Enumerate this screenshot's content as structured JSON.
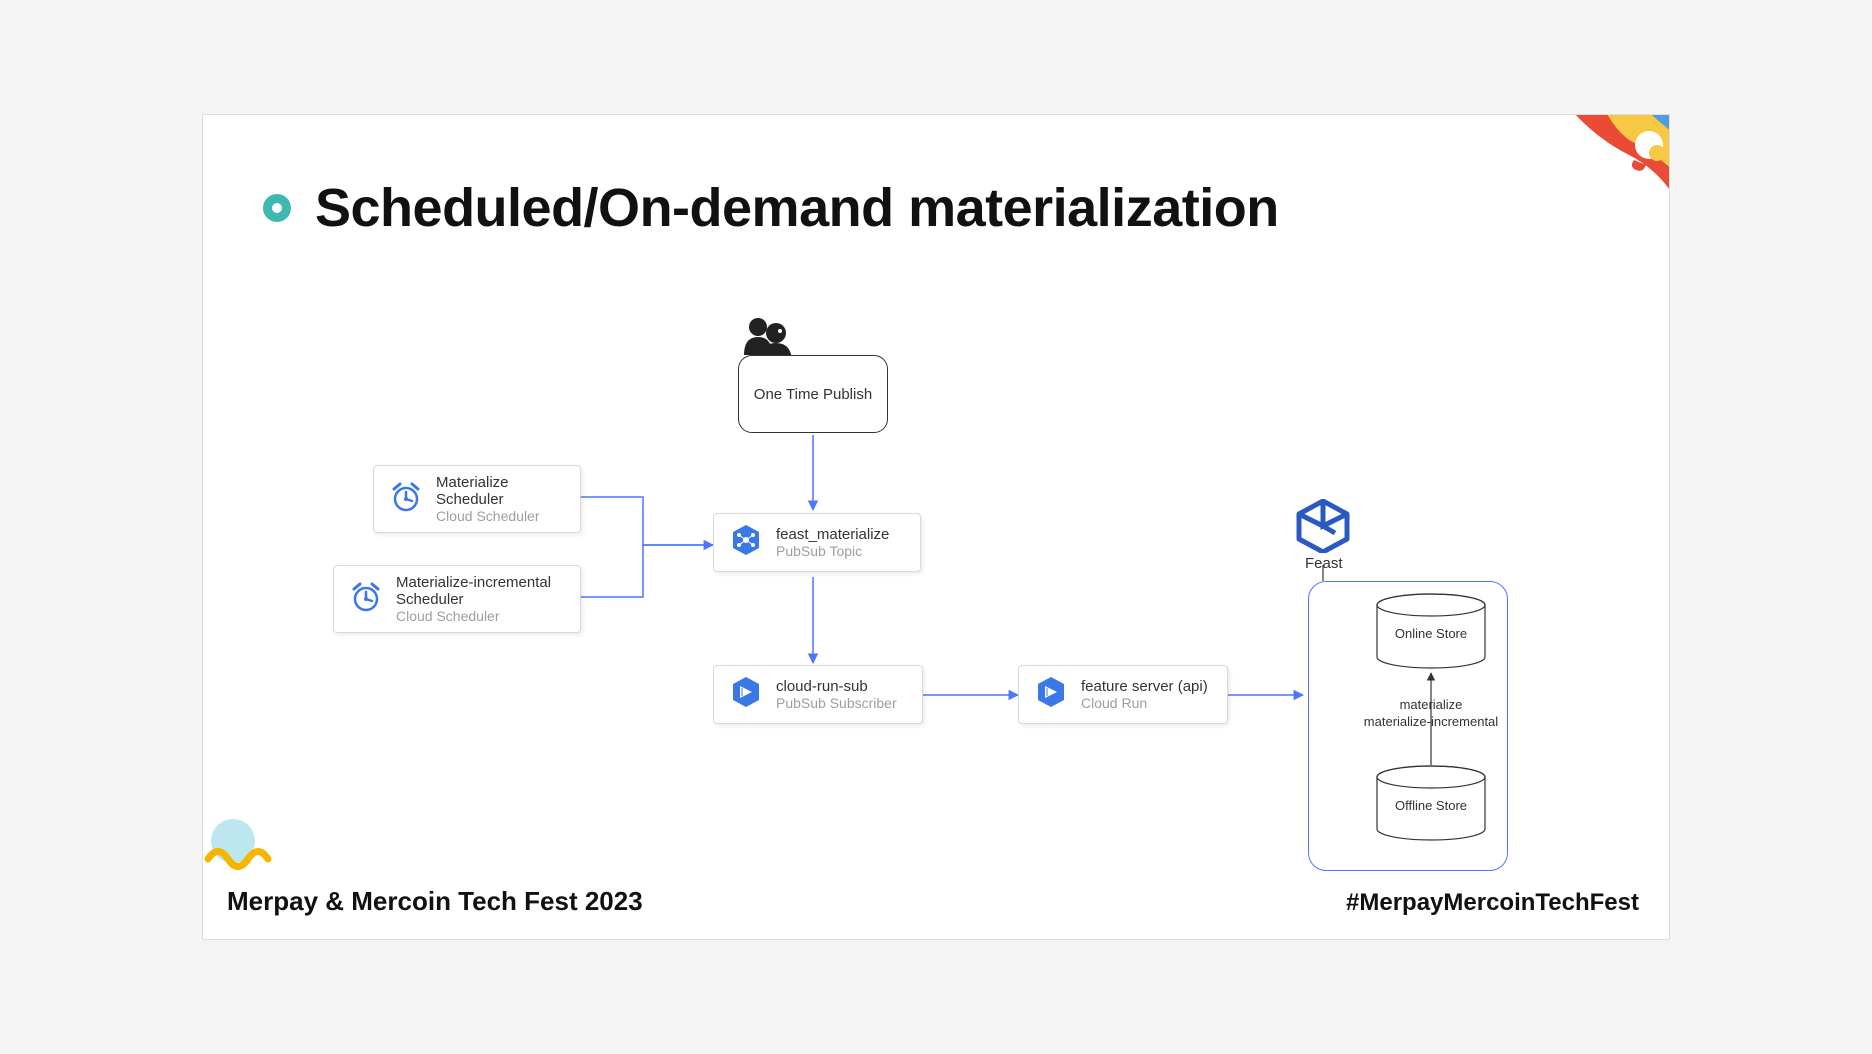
{
  "title": "Scheduled/On-demand materialization",
  "footer_left": "Merpay & Mercoin Tech Fest 2023",
  "footer_right": "#MerpayMercoinTechFest",
  "nodes": {
    "one_time": {
      "label": "One Time Publish"
    },
    "sched1": {
      "title": "Materialize Scheduler",
      "sub": "Cloud Scheduler"
    },
    "sched2": {
      "title": "Materialize-incremental Scheduler",
      "sub": "Cloud Scheduler"
    },
    "topic": {
      "title": "feast_materialize",
      "sub": "PubSub Topic"
    },
    "sub": {
      "title": "cloud-run-sub",
      "sub": "PubSub Subscriber"
    },
    "server": {
      "title": "feature server (api)",
      "sub": "Cloud Run"
    },
    "feast": {
      "label": "Feast"
    },
    "online": {
      "label": "Online Store"
    },
    "offline": {
      "label": "Offline Store"
    },
    "mat": {
      "line1": "materialize",
      "line2": "materialize-incremental"
    }
  }
}
